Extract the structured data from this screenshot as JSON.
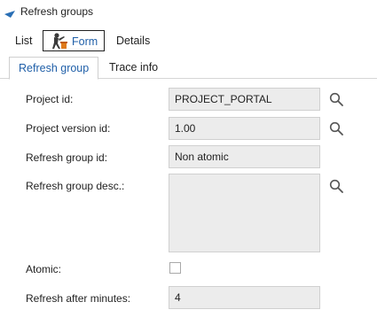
{
  "window": {
    "title": "Refresh groups"
  },
  "view_tabs": {
    "list": "List",
    "form": "Form",
    "details": "Details"
  },
  "sub_tabs": {
    "refresh_group": "Refresh group",
    "trace_info": "Trace info"
  },
  "form": {
    "project_id": {
      "label": "Project id:",
      "value": "PROJECT_PORTAL"
    },
    "project_version_id": {
      "label": "Project version id:",
      "value": "1.00"
    },
    "refresh_group_id": {
      "label": "Refresh group id:",
      "value": "Non atomic"
    },
    "refresh_group_desc": {
      "label": "Refresh group desc.:",
      "value": ""
    },
    "atomic": {
      "label": "Atomic:",
      "checked": false
    },
    "refresh_after_minutes": {
      "label": "Refresh after minutes:",
      "value": "4"
    }
  },
  "colors": {
    "accent": "#1f5fa8",
    "field_bg": "#ececec",
    "header_triangle": "#2a6fb5"
  },
  "icons": {
    "collapse": "triangle-collapse-icon",
    "form_view": "worker-icon",
    "lookup": "search-icon"
  }
}
